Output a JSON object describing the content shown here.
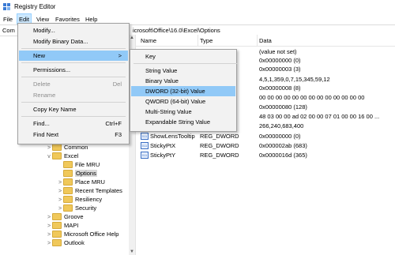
{
  "window": {
    "title": "Registry Editor"
  },
  "menubar": {
    "items": [
      "File",
      "Edit",
      "View",
      "Favorites",
      "Help"
    ]
  },
  "address": {
    "label": "Com",
    "path": "icrosoft\\Office\\16.0\\Excel\\Options"
  },
  "list": {
    "columns": [
      "Name",
      "Type",
      "Data"
    ],
    "rows": [
      {
        "name": "",
        "type": "",
        "data": "(value not set)"
      },
      {
        "name": "",
        "type": "",
        "data": "0x00000000 (0)"
      },
      {
        "name": "",
        "type": "",
        "data": "0x00000003 (3)"
      },
      {
        "name": "",
        "type": "",
        "data": "4,5,1,359,0,7,15,345,59,12"
      },
      {
        "name": "",
        "type": "",
        "data": "0x00000008 (8)"
      },
      {
        "name": "",
        "type": "",
        "data": "00 00 00 00 00 00 00 00 00 00 00 00 00"
      },
      {
        "name": "",
        "type": "",
        "data": "0x00000080 (128)"
      },
      {
        "name": "",
        "type": "",
        "data": "48 03 00 00 ad 02 00 00 07 01 00 00 16 00 ..."
      },
      {
        "name": "",
        "type": "",
        "data": "266,240,683,400"
      },
      {
        "name": "ShowLensTooltip",
        "type": "REG_DWORD",
        "data": "0x00000000 (0)"
      },
      {
        "name": "StickyPtX",
        "type": "REG_DWORD",
        "data": "0x000002ab (683)"
      },
      {
        "name": "StickyPtY",
        "type": "REG_DWORD",
        "data": "0x0000016d (365)"
      }
    ]
  },
  "tree": {
    "items": [
      {
        "label": "Common",
        "chevron": ">"
      },
      {
        "label": "Excel",
        "chevron": "v"
      },
      {
        "label": "File MRU",
        "chevron": ""
      },
      {
        "label": "Options",
        "chevron": ""
      },
      {
        "label": "Place MRU",
        "chevron": ">"
      },
      {
        "label": "Recent Templates",
        "chevron": ">"
      },
      {
        "label": "Resiliency",
        "chevron": ">"
      },
      {
        "label": "Security",
        "chevron": ">"
      },
      {
        "label": "Groove",
        "chevron": ">"
      },
      {
        "label": "MAPI",
        "chevron": ">"
      },
      {
        "label": "Microsoft Office Help",
        "chevron": ">"
      },
      {
        "label": "Outlook",
        "chevron": ">"
      }
    ]
  },
  "edit_menu": {
    "items": [
      {
        "label": "Modify...",
        "shortcut": "",
        "disabled": false
      },
      {
        "label": "Modify Binary Data...",
        "shortcut": "",
        "disabled": false
      },
      {
        "label": "New",
        "shortcut": ">",
        "disabled": false,
        "hover": true
      },
      {
        "label": "Permissions...",
        "shortcut": "",
        "disabled": false
      },
      {
        "label": "Delete",
        "shortcut": "Del",
        "disabled": true
      },
      {
        "label": "Rename",
        "shortcut": "",
        "disabled": true
      },
      {
        "label": "Copy Key Name",
        "shortcut": "",
        "disabled": false
      },
      {
        "label": "Find...",
        "shortcut": "Ctrl+F",
        "disabled": false
      },
      {
        "label": "Find Next",
        "shortcut": "F3",
        "disabled": false
      }
    ]
  },
  "new_menu": {
    "items": [
      {
        "label": "Key"
      },
      {
        "label": "String Value"
      },
      {
        "label": "Binary Value"
      },
      {
        "label": "DWORD (32-bit) Value",
        "hover": true
      },
      {
        "label": "QWORD (64-bit) Value"
      },
      {
        "label": "Multi-String Value"
      },
      {
        "label": "Expandable String Value"
      }
    ]
  },
  "colors": {
    "menu_hover": "#91c9f7",
    "menubar_active": "#cce8ff",
    "folder": "#f0c85a"
  }
}
